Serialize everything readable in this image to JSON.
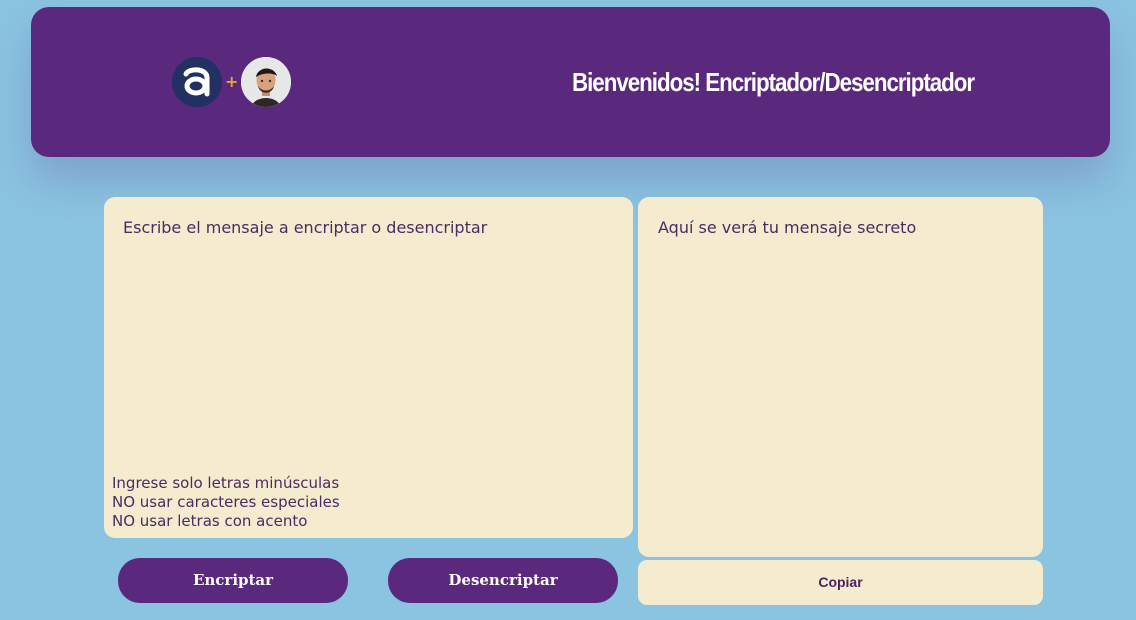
{
  "header": {
    "title": "Bienvenidos! Encriptador/Desencriptador",
    "logo": {
      "brand_icon": "alura-a-logo-icon",
      "separator": "+",
      "avatar_icon": "user-photo-avatar"
    }
  },
  "editor": {
    "input_placeholder": "Escribe el mensaje a encriptar o desencriptar",
    "input_value": "",
    "rules": [
      "Ingrese solo letras minúsculas",
      "NO usar caracteres especiales",
      "NO usar letras con acento"
    ]
  },
  "output": {
    "placeholder_text": "Aquí se verá tu mensaje secreto"
  },
  "buttons": {
    "encrypt_label": "Encriptar",
    "decrypt_label": "Desencriptar",
    "copy_label": "Copiar"
  },
  "colors": {
    "page_background": "#8ac4e1",
    "header_background": "#5a287d",
    "panel_background": "#f5ebce",
    "accent_orange": "#f1a132",
    "text_purple": "#4a2b63",
    "button_purple": "#5a287d"
  }
}
